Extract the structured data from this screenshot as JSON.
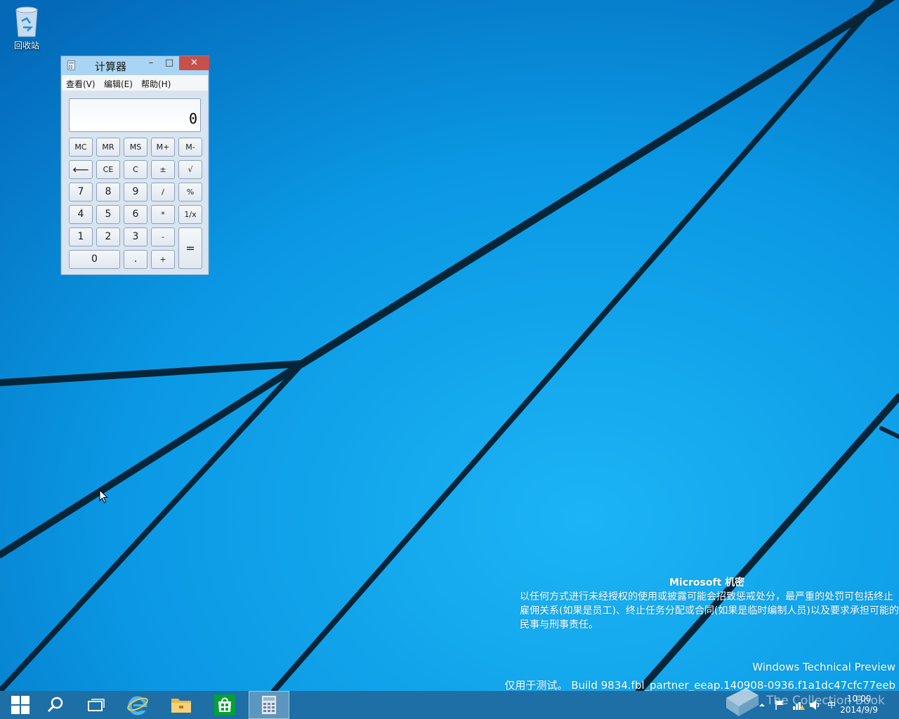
{
  "desktop": {
    "recycle_bin_label": "回收站"
  },
  "calculator": {
    "title": "计算器",
    "minimize_glyph": "–",
    "maximize_glyph": "□",
    "close_glyph": "✕",
    "menu": [
      "查看(V)",
      "编辑(E)",
      "帮助(H)"
    ],
    "display_value": "0",
    "memory_row": [
      "MC",
      "MR",
      "MS",
      "M+",
      "M-"
    ],
    "row2": [
      "⟵",
      "CE",
      "C",
      "±",
      "√"
    ],
    "row3": [
      "7",
      "8",
      "9",
      "/",
      "%"
    ],
    "row4": [
      "4",
      "5",
      "6",
      "*",
      "1/x"
    ],
    "row5": [
      "1",
      "2",
      "3",
      "-"
    ],
    "row6": [
      "0",
      ".",
      "+"
    ],
    "equals": "="
  },
  "watermark": {
    "title": "Microsoft 机密",
    "body": "以任何方式进行未经授权的使用或披露可能会招致惩戒处分，最严重的处罚可包括终止雇佣关系(如果是员工)、终止任务分配或合同(如果是临时编制人员)以及要求承担可能的民事与刑事责任。",
    "preview": "Windows Technical Preview",
    "build": "仅用于测试。 Build 9834.fbl_partner_eeap.140908-0936.f1a1dc47cfc77eeb"
  },
  "taskbar": {
    "ime": "中",
    "time": "10:00",
    "date": "2014/9/9",
    "overlay_text": "The Collection Book"
  },
  "colors": {
    "desktop_blue": "#0a8ee0",
    "taskbar": "#1d6fa5",
    "close_red": "#c7504a"
  }
}
